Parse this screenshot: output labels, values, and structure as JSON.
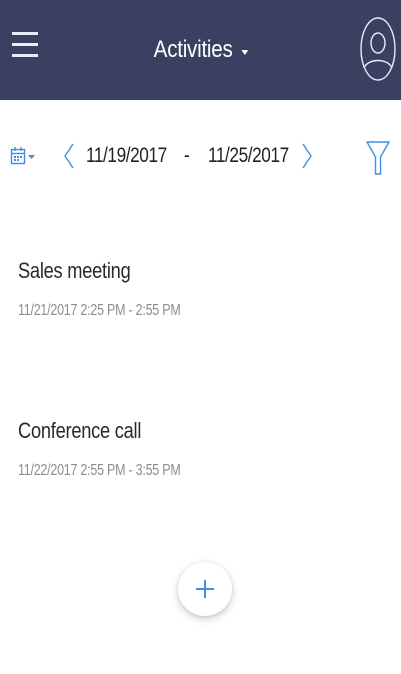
{
  "header": {
    "title": "Activities",
    "menu_icon": "hamburger-menu-icon",
    "avatar_icon": "user-avatar-icon",
    "background": "#3a4062"
  },
  "date_range": {
    "start": "11/19/2017",
    "separator": "-",
    "end": "11/25/2017",
    "calendar_icon": "calendar-icon",
    "prev_icon": "chevron-left-icon",
    "next_icon": "chevron-right-icon",
    "filter_icon": "filter-icon",
    "accent": "#3f8fe0"
  },
  "activities": [
    {
      "title": "Sales meeting",
      "time": "11/21/2017 2:25 PM - 2:55 PM"
    },
    {
      "title": "Conference call",
      "time": "11/22/2017 2:55 PM - 3:55 PM"
    }
  ],
  "fab": {
    "icon": "plus-icon",
    "color": "#3f8fe0"
  }
}
